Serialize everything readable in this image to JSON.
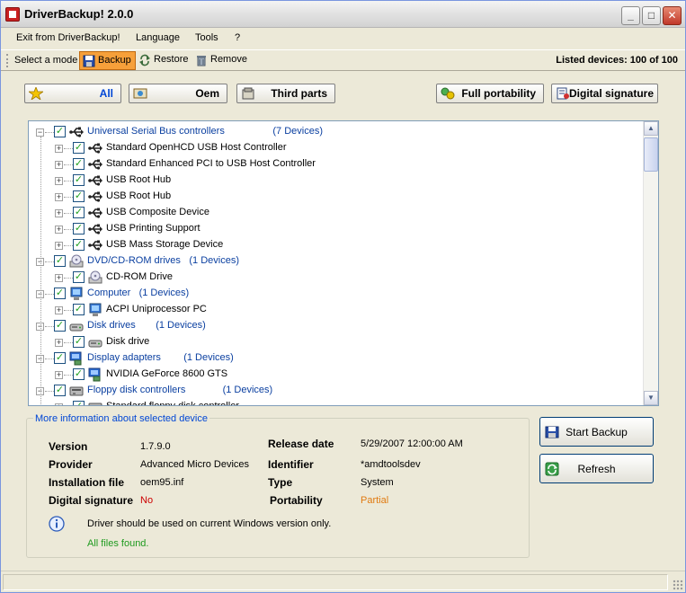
{
  "window": {
    "title": "DriverBackup! 2.0.0"
  },
  "titlebar_buttons": {
    "minimize": "_",
    "maximize": "□",
    "close": "✕"
  },
  "menu": [
    "Exit from DriverBackup!",
    "Language",
    "Tools",
    "?"
  ],
  "toolbar": {
    "mode_label": "Select a mode",
    "backup": "Backup",
    "restore": "Restore",
    "remove": "Remove",
    "listed_devices": "Listed devices: 100 of 100",
    "active_mode": "Backup"
  },
  "filters": {
    "all": "All",
    "oem": "Oem",
    "third_parts": "Third parts",
    "full_portability": "Full portability",
    "digital_signature": "Digital signature"
  },
  "tree": [
    {
      "type": "category",
      "label": "Universal Serial Bus controllers",
      "count": "(7 Devices)",
      "icon": "usb-icon",
      "checked": true
    },
    {
      "type": "device",
      "label": "Standard OpenHCD USB Host Controller",
      "icon": "usb-icon",
      "checked": true
    },
    {
      "type": "device",
      "label": "Standard Enhanced PCI to USB Host Controller",
      "icon": "usb-icon",
      "checked": true
    },
    {
      "type": "device",
      "label": "USB Root Hub",
      "icon": "usb-icon",
      "checked": true
    },
    {
      "type": "device",
      "label": "USB Root Hub",
      "icon": "usb-icon",
      "checked": true
    },
    {
      "type": "device",
      "label": "USB Composite Device",
      "icon": "usb-icon",
      "checked": true
    },
    {
      "type": "device",
      "label": "USB Printing Support",
      "icon": "usb-icon",
      "checked": true
    },
    {
      "type": "device",
      "label": "USB Mass Storage Device",
      "icon": "usb-icon",
      "checked": true
    },
    {
      "type": "category",
      "label": "DVD/CD-ROM drives",
      "count": "(1 Devices)",
      "icon": "cdrom-icon",
      "checked": true
    },
    {
      "type": "device",
      "label": "CD-ROM Drive",
      "icon": "cdrom-icon",
      "checked": true
    },
    {
      "type": "category",
      "label": "Computer",
      "count": "(1 Devices)",
      "icon": "computer-icon",
      "checked": true
    },
    {
      "type": "device",
      "label": "ACPI Uniprocessor PC",
      "icon": "computer-icon",
      "checked": true
    },
    {
      "type": "category",
      "label": "Disk drives",
      "count": "(1 Devices)",
      "icon": "disk-drive-icon",
      "checked": true
    },
    {
      "type": "device",
      "label": "Disk drive",
      "icon": "disk-drive-icon",
      "checked": true
    },
    {
      "type": "category",
      "label": "Display adapters",
      "count": "(1 Devices)",
      "icon": "display-adapter-icon",
      "checked": true
    },
    {
      "type": "device",
      "label": "NVIDIA GeForce 8600 GTS",
      "icon": "display-adapter-icon",
      "checked": true
    },
    {
      "type": "category",
      "label": "Floppy disk controllers",
      "count": "(1 Devices)",
      "icon": "floppy-controller-icon",
      "checked": true
    },
    {
      "type": "device",
      "label": "Standard floppy disk controller",
      "icon": "floppy-controller-icon",
      "checked": true
    }
  ],
  "info": {
    "legend": "More information about selected device",
    "version_label": "Version",
    "version": "1.7.9.0",
    "release_date_label": "Release date",
    "release_date": "5/29/2007 12:00:00 AM",
    "provider_label": "Provider",
    "provider": "Advanced Micro Devices",
    "identifier_label": "Identifier",
    "identifier": "*amdtoolsdev",
    "installation_file_label": "Installation file",
    "installation_file": "oem95.inf",
    "type_label": "Type",
    "type": "System",
    "digital_signature_label": "Digital signature",
    "digital_signature": "No",
    "portability_label": "Portability",
    "portability": "Partial",
    "note": "Driver should be used on current Windows version only.",
    "files_status": "All files found."
  },
  "actions": {
    "start_backup": "Start Backup",
    "refresh": "Refresh"
  },
  "colors": {
    "category_text": "#0a3fa0",
    "signature_no": "#cc0000",
    "portability_partial": "#e07a10",
    "files_ok": "#1e9a1e",
    "active_tool": "#f6a03a"
  }
}
